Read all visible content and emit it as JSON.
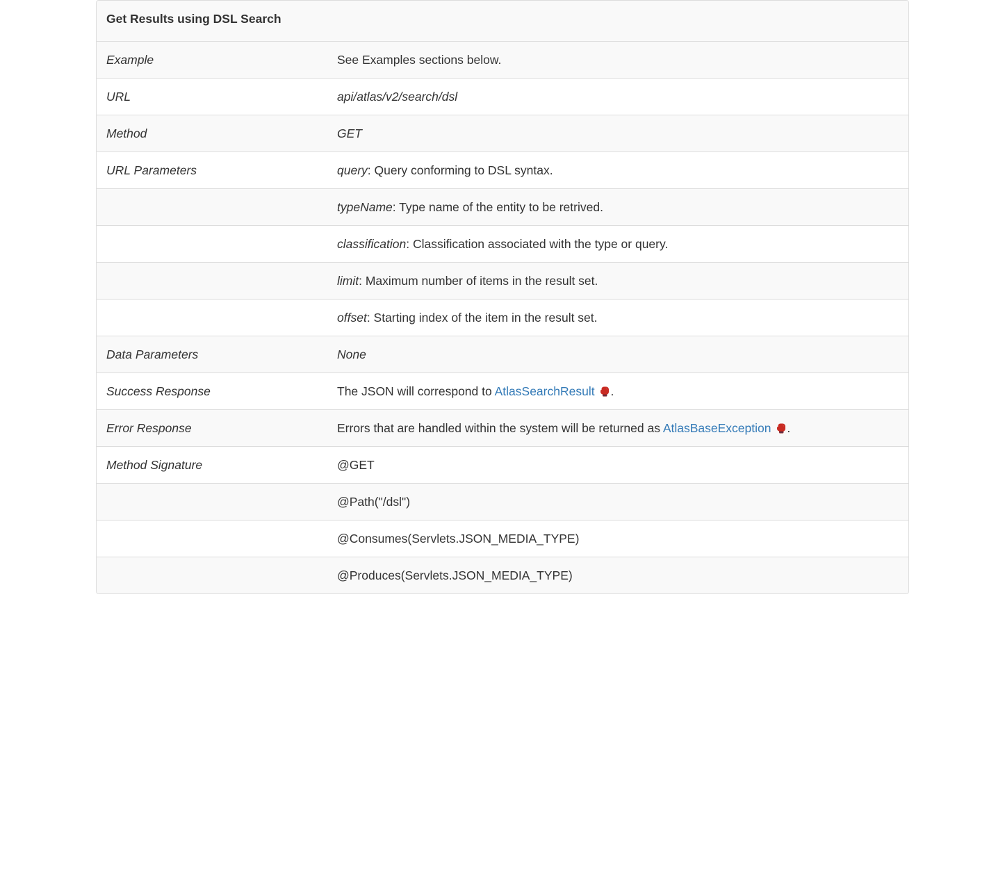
{
  "title": "Get Results using DSL Search",
  "rows": {
    "example": {
      "label": "Example",
      "value": "See Examples sections below."
    },
    "url": {
      "label": "URL",
      "value": "api/atlas/v2/search/dsl"
    },
    "method": {
      "label": "Method",
      "value": "GET"
    },
    "urlParams": {
      "label": "URL Parameters"
    },
    "params": [
      {
        "name": "query",
        "desc": ": Query conforming to DSL syntax."
      },
      {
        "name": "typeName",
        "desc": ": Type name of the entity to be retrived."
      },
      {
        "name": "classification",
        "desc": ": Classification associated with the type or query."
      },
      {
        "name": "limit",
        "desc": ": Maximum number of items in the result set."
      },
      {
        "name": "offset",
        "desc": ": Starting index of the item in the result set."
      }
    ],
    "dataParams": {
      "label": "Data Parameters",
      "value": "None"
    },
    "success": {
      "label": "Success Response",
      "prefix": "The JSON will correspond to ",
      "link": "AtlasSearchResult",
      "suffix": "."
    },
    "error": {
      "label": "Error Response",
      "prefix": "Errors that are handled within the system will be returned as ",
      "link": "AtlasBaseException",
      "suffix": "."
    },
    "sig": {
      "label": "Method Signature"
    },
    "sigLines": [
      "@GET",
      "@Path(\"/dsl\")",
      "@Consumes(Servlets.JSON_MEDIA_TYPE)",
      "@Produces(Servlets.JSON_MEDIA_TYPE)"
    ]
  }
}
